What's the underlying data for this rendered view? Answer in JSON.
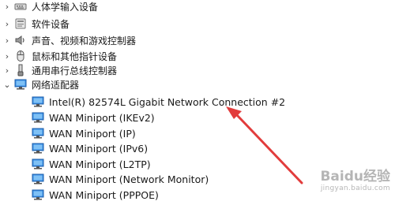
{
  "tree": {
    "categories": [
      {
        "label": "人体学输入设备",
        "icon": "hid-icon",
        "state": "collapsed"
      },
      {
        "label": "软件设备",
        "icon": "software-device-icon",
        "state": "collapsed"
      },
      {
        "label": "声音、视频和游戏控制器",
        "icon": "speaker-icon",
        "state": "collapsed"
      },
      {
        "label": "鼠标和其他指针设备",
        "icon": "mouse-icon",
        "state": "collapsed"
      },
      {
        "label": "通用串行总线控制器",
        "icon": "usb-icon",
        "state": "collapsed"
      },
      {
        "label": "网络适配器",
        "icon": "network-adapter-icon",
        "state": "expanded",
        "selected": true
      }
    ],
    "network_adapters": [
      "Intel(R) 82574L Gigabit Network Connection #2",
      "WAN Miniport (IKEv2)",
      "WAN Miniport (IP)",
      "WAN Miniport (IPv6)",
      "WAN Miniport (L2TP)",
      "WAN Miniport (Network Monitor)",
      "WAN Miniport (PPPOE)"
    ]
  },
  "annotation": {
    "color": "#e23c3c"
  },
  "watermark": {
    "logo": "Baidu经验",
    "url": "jingyan.baidu.com"
  }
}
